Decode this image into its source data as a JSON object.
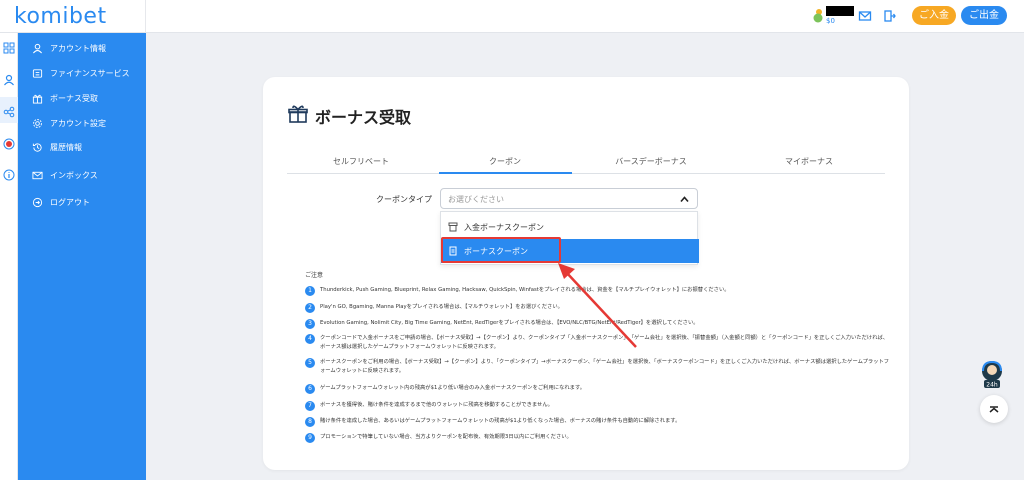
{
  "header": {
    "logo": "komibet",
    "balance": "$0",
    "deposit_label": "ご入金",
    "withdraw_label": "ご出金"
  },
  "sidebar": {
    "items": [
      {
        "label": "アカウント情報",
        "icon": "user-icon"
      },
      {
        "label": "ファイナンスサービス",
        "icon": "finance-icon"
      },
      {
        "label": "ボーナス受取",
        "icon": "gift-icon"
      },
      {
        "label": "アカウント設定",
        "icon": "gear-icon"
      },
      {
        "label": "履歴情報",
        "icon": "history-icon"
      },
      {
        "label": "インボックス",
        "icon": "mail-icon"
      },
      {
        "label": "ログアウト",
        "icon": "logout-icon"
      }
    ]
  },
  "card": {
    "title": "ボーナス受取",
    "tabs": [
      "セルフリベート",
      "クーポン",
      "バースデーボーナス",
      "マイボーナス"
    ],
    "active_tab": 1,
    "coupon_type_label": "クーポンタイプ",
    "select_placeholder": "お選びください",
    "options": [
      "入金ボーナスクーポン",
      "ボーナスクーポン"
    ],
    "selected_option": 1,
    "notice_title": "ご注意",
    "notes": [
      "Thunderkick, Push Gaming, Blueprint, Relax Gaming, Hacksaw, QuickSpin, Winfastをプレイされる場合は、資金を【マルチプレイウォレット】にお振替ください。",
      "Play'n GO, Bgaming, Manna Playをプレイされる場合は、【マルチウォレット】をお選びください。",
      "Evolution Gaming, Nolimit City, Big Time Gaming, NetEnt, RedTigerをプレイされる場合は、【EVO/NLC/BTG/NetEnt/RedTiger】を選択してください。",
      "クーポンコードで入金ボーナスをご申請の場合、【ボーナス受取】→【クーポン】より、クーポンタイプ「入金ボーナスクーポン」、「ゲーム会社」を選択後、「振替金額」（入金額と同額）と「クーポンコード」を正しくご入力いただければ、ボーナス額は選択したゲームプラットフォームウォレットに反映されます。",
      "ボーナスクーポンをご利用の場合、【ボーナス受取】→【クーポン】より、「クーポンタイプ」→ボーナスクーポン、「ゲーム会社」を選択後、「ボーナスクーポンコード」を正しくご入力いただければ、ボーナス額は選択したゲームプラットフォームウォレットに反映されます。",
      "ゲームプラットフォームウォレット内の残高が$1より低い場合のみ入金ボーナスクーポンをご利用になれます。",
      "ボーナスを獲得後、賭け条件を達成するまで他のウォレットに残高を移動することができません。",
      "賭け条件を達成した場合、あるいはゲームプラットフォームウォレットの残高が$1より低くなった場合、ボーナスの賭け条件も自動的に解除されます。",
      "プロモーションで特筆していない場合、当方よりクーポンを配布後、有効期限3日以内にご利用ください。"
    ]
  },
  "floating": {
    "chat_badge": "24h"
  },
  "colors": {
    "brand_blue": "#2a8af0",
    "deposit_orange": "#f7a823",
    "highlight_red": "#e53935"
  }
}
